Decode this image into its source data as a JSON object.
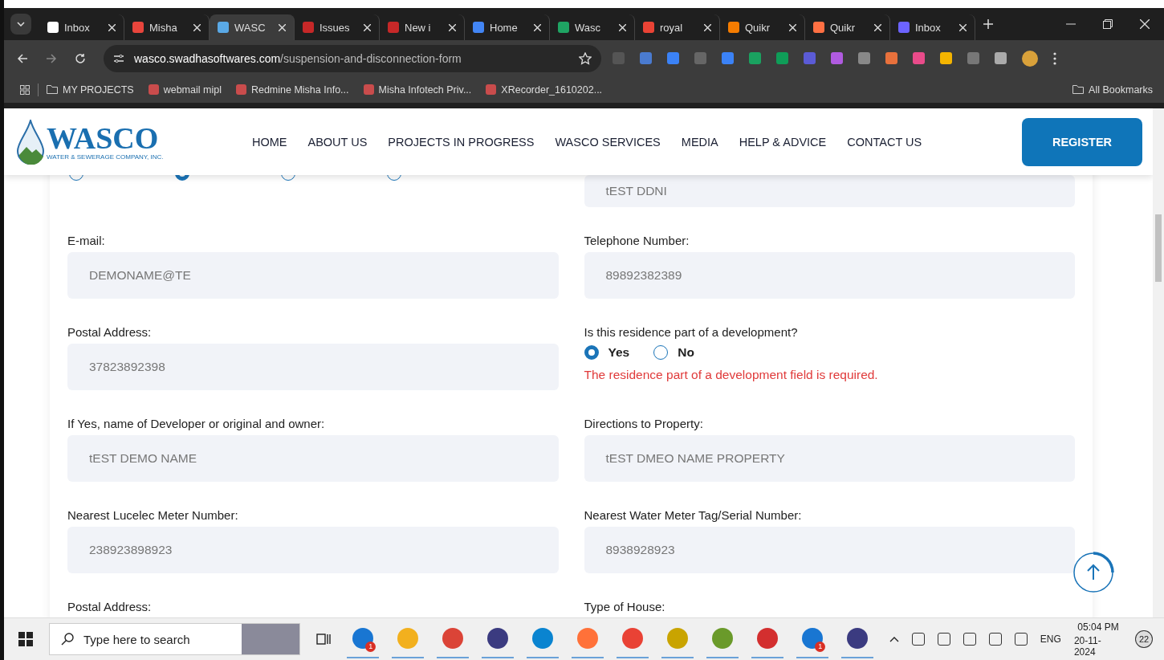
{
  "browser": {
    "tabs": [
      {
        "label": "Inbox",
        "selected": false,
        "color": "#ffffff"
      },
      {
        "label": "Misha",
        "selected": false,
        "color": "#e8453c"
      },
      {
        "label": "WASC",
        "selected": true,
        "color": "#5aa9e6"
      },
      {
        "label": "Issues",
        "selected": false,
        "color": "#c62828"
      },
      {
        "label": "New i",
        "selected": false,
        "color": "#c62828"
      },
      {
        "label": "Home",
        "selected": false,
        "color": "#4285f4"
      },
      {
        "label": "Wasc",
        "selected": false,
        "color": "#1fa463"
      },
      {
        "label": "royal",
        "selected": false,
        "color": "#ea4335"
      },
      {
        "label": "Quikr",
        "selected": false,
        "color": "#f57c00"
      },
      {
        "label": "Quikr",
        "selected": false,
        "color": "#ff7043"
      },
      {
        "label": "Inbox",
        "selected": false,
        "color": "#6c63ff"
      }
    ],
    "url_host": "wasco.swadhasoftwares.com",
    "url_path": "/suspension-and-disconnection-form",
    "bookmarks": [
      {
        "label": "MY PROJECTS",
        "kind": "folder"
      },
      {
        "label": "webmail mipl",
        "kind": "site"
      },
      {
        "label": "Redmine Misha Info...",
        "kind": "site"
      },
      {
        "label": "Misha Infotech Priv...",
        "kind": "site"
      },
      {
        "label": "XRecorder_1610202...",
        "kind": "site"
      }
    ],
    "all_bookmarks": "All Bookmarks"
  },
  "site": {
    "logo_title": "WASCO",
    "logo_subtitle": "WATER & SEWERAGE COMPANY, INC.",
    "nav": [
      "HOME",
      "ABOUT US",
      "PROJECTS IN PROGRESS",
      "WASCO SERVICES",
      "MEDIA",
      "HELP & ADVICE",
      "CONTACT US"
    ],
    "register": "REGISTER"
  },
  "form": {
    "top_radios": [
      {
        "selected": false
      },
      {
        "selected": true
      },
      {
        "selected": false
      },
      {
        "selected": false
      }
    ],
    "top_right_value": "tEST DDNI",
    "rows": [
      [
        {
          "kind": "field",
          "label": "E-mail:",
          "value": "DEMONAME@TE"
        },
        {
          "kind": "field",
          "label": "Telephone Number:",
          "value": "89892382389"
        }
      ],
      [
        {
          "kind": "field",
          "label": "Postal Address:",
          "value": "37823892398"
        },
        {
          "kind": "radio",
          "label": "Is this residence part of a development?",
          "options": [
            {
              "label": "Yes",
              "selected": true
            },
            {
              "label": "No",
              "selected": false
            }
          ],
          "error": "The residence part of a development field is required."
        }
      ],
      [
        {
          "kind": "field",
          "label": "If Yes, name of Developer or original and owner:",
          "value": "tEST DEMO NAME"
        },
        {
          "kind": "field",
          "label": "Directions to Property:",
          "value": "tEST DMEO NAME PROPERTY"
        }
      ],
      [
        {
          "kind": "field",
          "label": "Nearest Lucelec Meter Number:",
          "value": "238923898923"
        },
        {
          "kind": "field",
          "label": "Nearest Water Meter Tag/Serial Number:",
          "value": "8938928923"
        }
      ],
      [
        {
          "kind": "label",
          "label": "Postal Address:"
        },
        {
          "kind": "label",
          "label": "Type of House:"
        }
      ]
    ]
  },
  "taskbar": {
    "search_placeholder": "Type here to search",
    "badges": [
      "1",
      "1"
    ],
    "language": "ENG",
    "time": "05:04 PM",
    "date": "20-11-2024",
    "notifications": "22"
  }
}
